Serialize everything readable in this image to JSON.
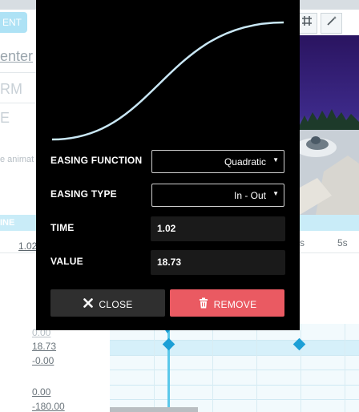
{
  "background": {
    "tag_button": "ENT",
    "panel": {
      "link_text": "enter",
      "heading_1": "RM",
      "heading_2": "E",
      "description": "e animat"
    },
    "section_label": "INE",
    "ruler": {
      "current_value": "1.02",
      "ticks": [
        "s",
        "5s"
      ]
    },
    "toolbar_icons": [
      "grid-icon",
      "magic-wand-icon"
    ],
    "value_column": {
      "row_values": [
        "0.00",
        "18.73",
        "-0.00"
      ],
      "row_values_2": [
        "0.00",
        "-180.00"
      ]
    }
  },
  "dialog": {
    "easing_function": {
      "label": "EASING FUNCTION",
      "value": "Quadratic"
    },
    "easing_type": {
      "label": "EASING TYPE",
      "value": "In - Out"
    },
    "time": {
      "label": "TIME",
      "value": "1.02"
    },
    "value": {
      "label": "VALUE",
      "value": "18.73"
    },
    "close_button": "CLOSE",
    "remove_button": "REMOVE",
    "curve_color": "#c9e7f5"
  },
  "colors": {
    "accent": "#1b9fd6",
    "remove": "#ea5a62"
  }
}
